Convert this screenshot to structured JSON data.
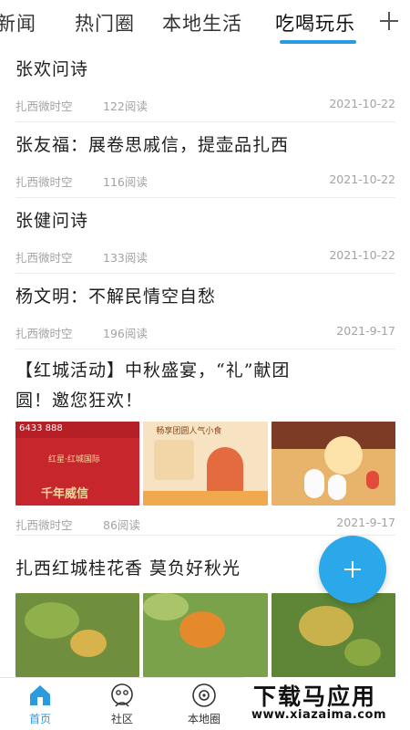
{
  "tabs": [
    {
      "label": "新闻"
    },
    {
      "label": "热门圈"
    },
    {
      "label": "本地生活"
    },
    {
      "label": "吃喝玩乐"
    }
  ],
  "accent_color": "#2b9be0",
  "add_tab_icon": "plus-icon",
  "articles": [
    {
      "title": "张欢问诗",
      "source": "扎西微时空",
      "reads": "122阅读",
      "date": "2021-10-22"
    },
    {
      "title": "张友福：展卷思戚信，提壶品扎西",
      "source": "扎西微时空",
      "reads": "116阅读",
      "date": "2021-10-22"
    },
    {
      "title": "张健问诗",
      "source": "扎西微时空",
      "reads": "133阅读",
      "date": "2021-10-22"
    },
    {
      "title": "杨文明：不解民情空自愁",
      "source": "扎西微时空",
      "reads": "196阅读",
      "date": "2021-9-17"
    },
    {
      "title_line1": "【红城活动】中秋盛宴，“礼”献团",
      "title_line2": "圆！邀您狂欢！",
      "source": "扎西微时空",
      "reads": "86阅读",
      "date": "2021-9-17",
      "thumb1_text_a": "红星·红城国际",
      "thumb1_text_b": "千年威信",
      "thumb1_phone": "6433 888",
      "thumb2_text_a": "畅享团圆人气小食"
    },
    {
      "title": "扎西红城桂花香  莫负好秋光"
    }
  ],
  "fab_icon": "plus-icon",
  "bottom_nav": [
    {
      "label": "首页",
      "icon": "home-icon"
    },
    {
      "label": "社区",
      "icon": "community-icon"
    },
    {
      "label": "本地圈",
      "icon": "local-circle-icon"
    }
  ],
  "watermark": {
    "big": "下载马应用",
    "small": "www.xiazaima.com"
  }
}
